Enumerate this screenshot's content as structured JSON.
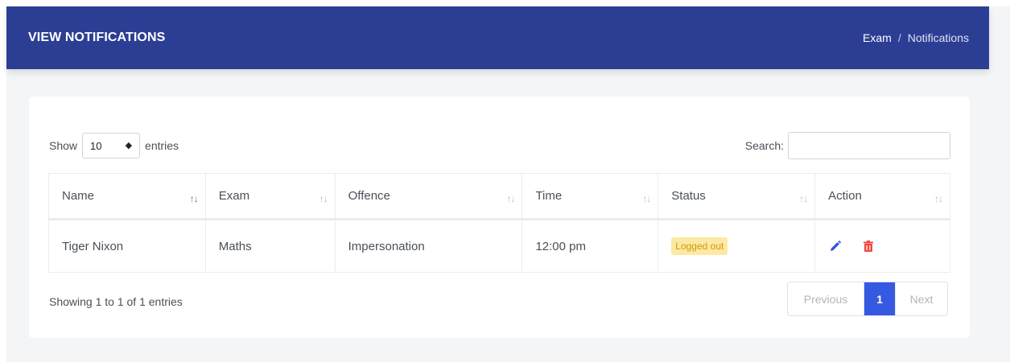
{
  "header": {
    "title": "VIEW NOTIFICATIONS",
    "breadcrumb": {
      "parent": "Exam",
      "separator": "/",
      "current": "Notifications"
    }
  },
  "controls": {
    "show_label": "Show",
    "page_size": "10",
    "entries_label": "entries",
    "search_label": "Search:",
    "search_value": ""
  },
  "table": {
    "columns": [
      "Name",
      "Exam",
      "Offence",
      "Time",
      "Status",
      "Action"
    ],
    "rows": [
      {
        "name": "Tiger Nixon",
        "exam": "Maths",
        "offence": "Impersonation",
        "time": "12:00 pm",
        "status": "Logged out",
        "actions": [
          "pencil-icon",
          "trash-icon"
        ]
      }
    ]
  },
  "footer": {
    "info": "Showing 1 to 1 of 1 entries",
    "pagination": {
      "previous": "Previous",
      "current": "1",
      "next": "Next"
    }
  },
  "colors": {
    "header_bg": "#2c3e94",
    "accent": "#3559e0",
    "badge_bg": "#fde9a5",
    "badge_text": "#d09a00",
    "delete": "#f1473b"
  }
}
